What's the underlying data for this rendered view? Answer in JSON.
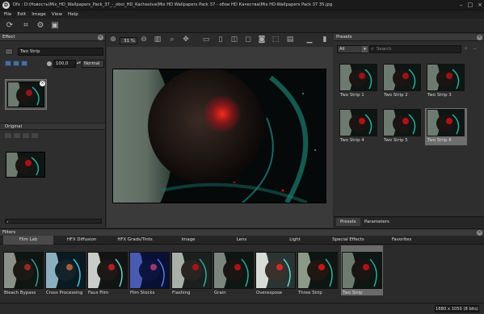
{
  "window": {
    "title": "Dfx : D:\\Новость\\Mix_HD_Wallpapers_Pack_37_-_oboi_HD_Kachestva\\Mix HD Wallpapers Pack 37 - обои HD Качества\\Mix HD-Wallpapers Pack 37 35.jpg",
    "logo": "D"
  },
  "menu": [
    "File",
    "Edit",
    "Image",
    "View",
    "Help"
  ],
  "effect_panel": {
    "title": "Effect",
    "effect_name": "Two Strip",
    "amount": "100,0",
    "blend_mode": "Normal",
    "original_title": "Original"
  },
  "canvas": {
    "zoom": "31 %"
  },
  "presets_panel": {
    "title": "Presets",
    "filter_value": "All",
    "search_placeholder": "Search",
    "items": [
      {
        "label": "Two Strip 1"
      },
      {
        "label": "Two Strip 2"
      },
      {
        "label": "Two Strip 3"
      },
      {
        "label": "Two Strip 4"
      },
      {
        "label": "Two Strip 5"
      },
      {
        "label": "Two Strip 6"
      }
    ],
    "selected_index": 5,
    "tabs": [
      "Presets",
      "Parameters"
    ]
  },
  "filters_panel": {
    "title": "Filters",
    "tabs": [
      "Film Lab",
      "HFX Diffusion",
      "HFX Grads/Tints",
      "Image",
      "Lens",
      "Light",
      "Special Effects",
      "Favorites"
    ],
    "active_tab": 0,
    "items": [
      {
        "label": "Bleach Bypass"
      },
      {
        "label": "Cross Processing"
      },
      {
        "label": "Faux Film"
      },
      {
        "label": "Film Stocks"
      },
      {
        "label": "Flashing"
      },
      {
        "label": "Grain"
      },
      {
        "label": "Overexpose"
      },
      {
        "label": "Three Strip"
      },
      {
        "label": "Two Strip"
      }
    ],
    "selected_index": 8
  },
  "status": {
    "dimensions": "1680 x 1050 (8 bits)"
  },
  "colors": {
    "accent_red": "#c0121a",
    "teal_glow": "#2fc0b0",
    "panel": "#2e2e2e",
    "header": "#3a3a3a"
  }
}
